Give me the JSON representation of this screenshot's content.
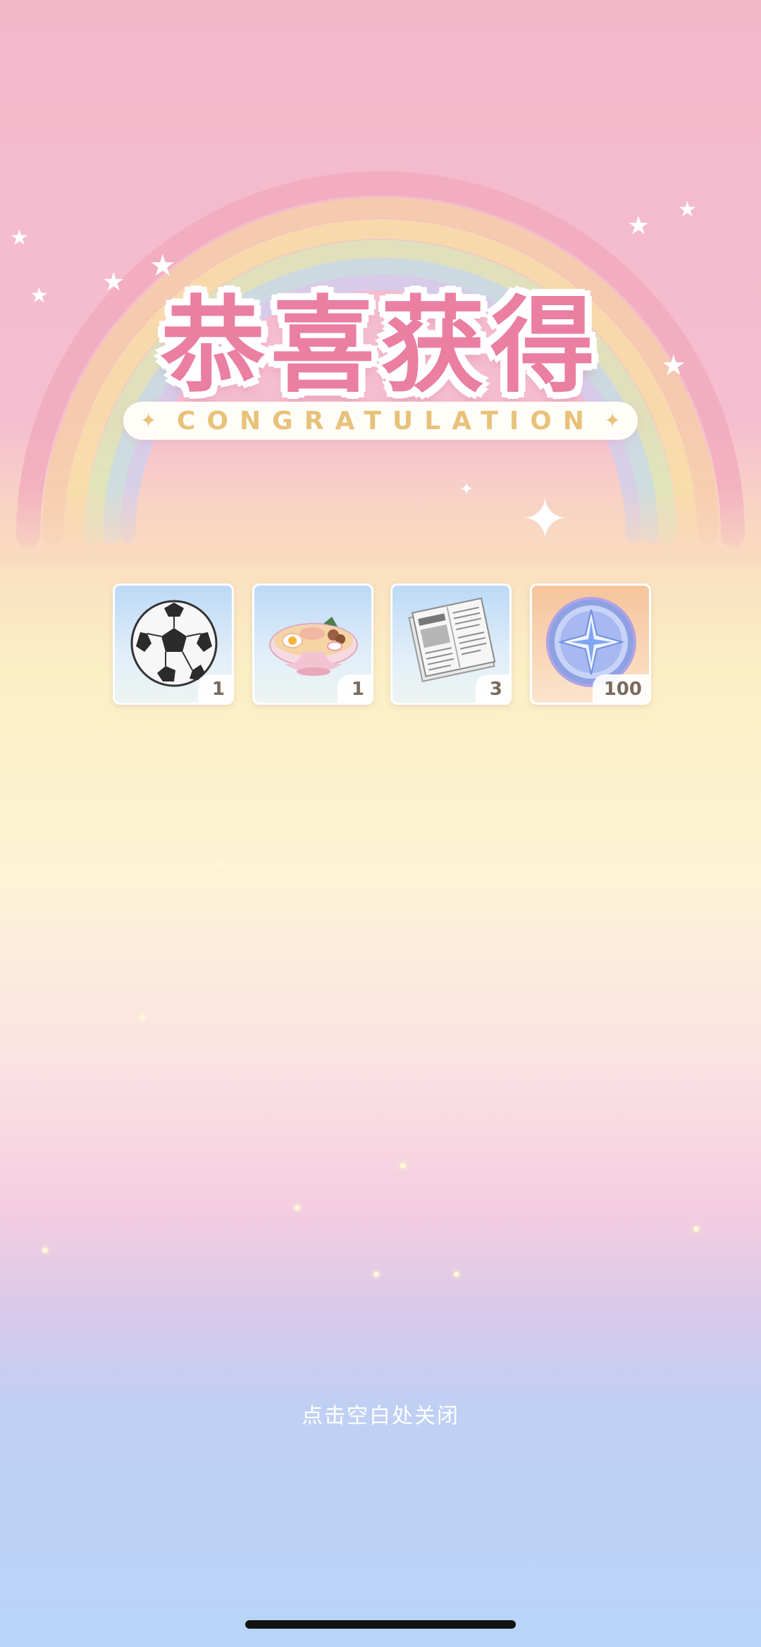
{
  "title": "恭喜获得",
  "subtitle": "CONGRATULATION",
  "rewards": [
    {
      "name": "soccer-ball",
      "quantity": "1"
    },
    {
      "name": "ramen-bowl",
      "quantity": "1"
    },
    {
      "name": "newspaper",
      "quantity": "3"
    },
    {
      "name": "star-coin",
      "quantity": "100"
    }
  ],
  "close_hint": "点击空白处关闭",
  "colors": {
    "title": "#ea7fa1",
    "subtitle": "#e8c27a",
    "quantity_text": "#7a6b5d"
  }
}
